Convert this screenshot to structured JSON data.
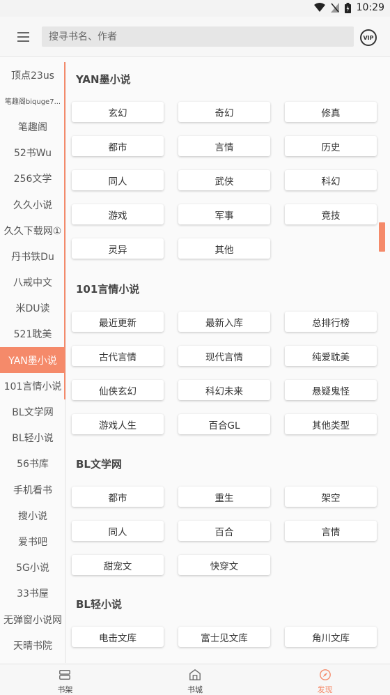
{
  "status_bar": {
    "time": "10:29"
  },
  "header": {
    "menu_icon": "hamburger-menu-icon",
    "search_placeholder": "搜寻书名、作者",
    "vip_label": "VIP"
  },
  "colors": {
    "accent": "#f58a6a"
  },
  "sidebar": {
    "selected_index": 11,
    "items": [
      "顶点23us",
      "笔趣阁biquge7...",
      "笔趣阁",
      "52书Wu",
      "256文学",
      "久久小说",
      "久久下载网①",
      "丹书铁Du",
      "八戒中文",
      "米DU读",
      "521耽美",
      "YAN墨小说",
      "101言情小说",
      "BL文学网",
      "BL轻小说",
      "56书库",
      "手机看书",
      "搜小说",
      "爱书吧",
      "5G小说",
      "33书屋",
      "无弹窗小说网",
      "天晴书院"
    ]
  },
  "sections": [
    {
      "title": "YAN墨小说",
      "tags": [
        "玄幻",
        "奇幻",
        "修真",
        "都市",
        "言情",
        "历史",
        "同人",
        "武侠",
        "科幻",
        "游戏",
        "军事",
        "竞技",
        "灵异",
        "其他"
      ]
    },
    {
      "title": "101言情小说",
      "tags": [
        "最近更新",
        "最新入库",
        "总排行榜",
        "古代言情",
        "现代言情",
        "纯爱耽美",
        "仙侠玄幻",
        "科幻未来",
        "悬疑鬼怪",
        "游戏人生",
        "百合GL",
        "其他类型"
      ]
    },
    {
      "title": "BL文学网",
      "tags": [
        "都市",
        "重生",
        "架空",
        "同人",
        "百合",
        "言情",
        "甜宠文",
        "快穿文"
      ]
    },
    {
      "title": "BL轻小说",
      "tags": [
        "电击文库",
        "富士见文库",
        "角川文库"
      ]
    }
  ],
  "bottom_nav": [
    {
      "label": "书架",
      "icon": "bookshelf-icon"
    },
    {
      "label": "书城",
      "icon": "bookstore-icon"
    },
    {
      "label": "发现",
      "icon": "compass-icon",
      "active": true
    }
  ]
}
